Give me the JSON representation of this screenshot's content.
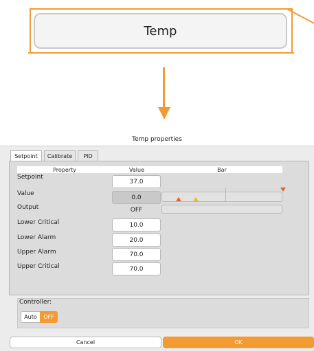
{
  "preview": {
    "button_label": "Temp"
  },
  "window": {
    "title": "Temp properties"
  },
  "tabs": [
    {
      "label": "Setpoint",
      "active": true
    },
    {
      "label": "Calibrate",
      "active": false
    },
    {
      "label": "PID",
      "active": false
    }
  ],
  "table": {
    "headers": {
      "property": "Property",
      "value": "Value",
      "bar": "Bar"
    },
    "rows": [
      {
        "label": "Setpoint",
        "value": "37.0"
      },
      {
        "label": "Value",
        "value": "0.0"
      },
      {
        "label": "Output",
        "value": "OFF"
      },
      {
        "label": "Lower Critical",
        "value": "10.0"
      },
      {
        "label": "Lower Alarm",
        "value": "20.0"
      },
      {
        "label": "Upper Alarm",
        "value": "70.0"
      },
      {
        "label": "Upper Critical",
        "value": "70.0"
      }
    ]
  },
  "controller": {
    "label": "Controller:",
    "auto_label": "Auto",
    "off_label": "OFF",
    "selected": "OFF"
  },
  "buttons": {
    "cancel_label": "Cancel",
    "ok_label": "OK"
  },
  "colors": {
    "accent": "#f39a33",
    "critical_marker": "#e0662a",
    "alarm_marker": "#f0b838"
  },
  "icons": {
    "arrow": "down-arrow-icon",
    "marker_up": "triangle-up-icon",
    "marker_down": "triangle-down-icon"
  }
}
